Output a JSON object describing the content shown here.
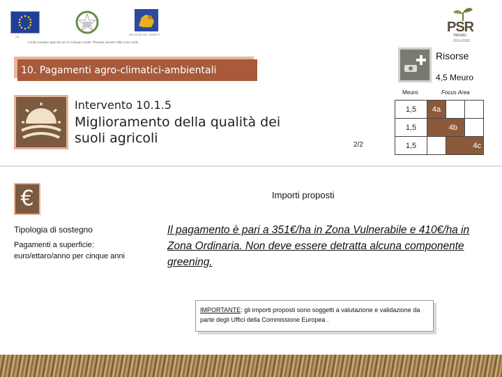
{
  "header": {
    "eu_caption": "UE",
    "region_caption": "REGIONE DEL VENETO",
    "tagline": "Fondo europeo agricolo per lo sviluppo rurale: l'Europa investe nelle zone rurali",
    "psr_logo": "PSR",
    "psr_region": "Veneto",
    "psr_years": "2014-2020"
  },
  "section": {
    "title": "10. Pagamenti agro-climatici-ambientali"
  },
  "resources": {
    "title": "Risorse",
    "amount": "4,5  Meuro",
    "col_meuro": "Meuro",
    "col_focus": "Focus Area",
    "rows": [
      {
        "meuro": "1,5",
        "c1": "4a",
        "c2": "",
        "c3": ""
      },
      {
        "meuro": "1,5",
        "c1": "",
        "c2": "4b",
        "c3": ""
      },
      {
        "meuro": "1,5",
        "c1": "",
        "c2": "",
        "c3": "4c"
      }
    ],
    "fill_color": "#8b5a3a"
  },
  "intervention": {
    "code": "Intervento  10.1.5",
    "title": "Miglioramento della qualità dei suoli agricoli",
    "page": "2/2"
  },
  "amounts": {
    "title": "Importi proposti",
    "support_type_title": "Tipologia di sostegno",
    "support_type_desc": "Pagamenti a superficie: euro/ettaro/anno per cinque anni",
    "payment_text": "Il pagamento è pari a 351€/ha in Zona Vulnerabile e 410€/ha in Zona Ordinaria. Non deve essere detratta alcuna componente greening.",
    "euro_symbol": "€"
  },
  "note": {
    "label": "IMPORTANTE",
    "text": ": gli importi proposti sono soggetti a valutazione e validazione da parte degli Uffici della Commissione Europea ."
  },
  "colors": {
    "heading_bg": "#a85a3a",
    "icon_bg": "#7b5a3f",
    "accent_light": "#e4b49a"
  }
}
